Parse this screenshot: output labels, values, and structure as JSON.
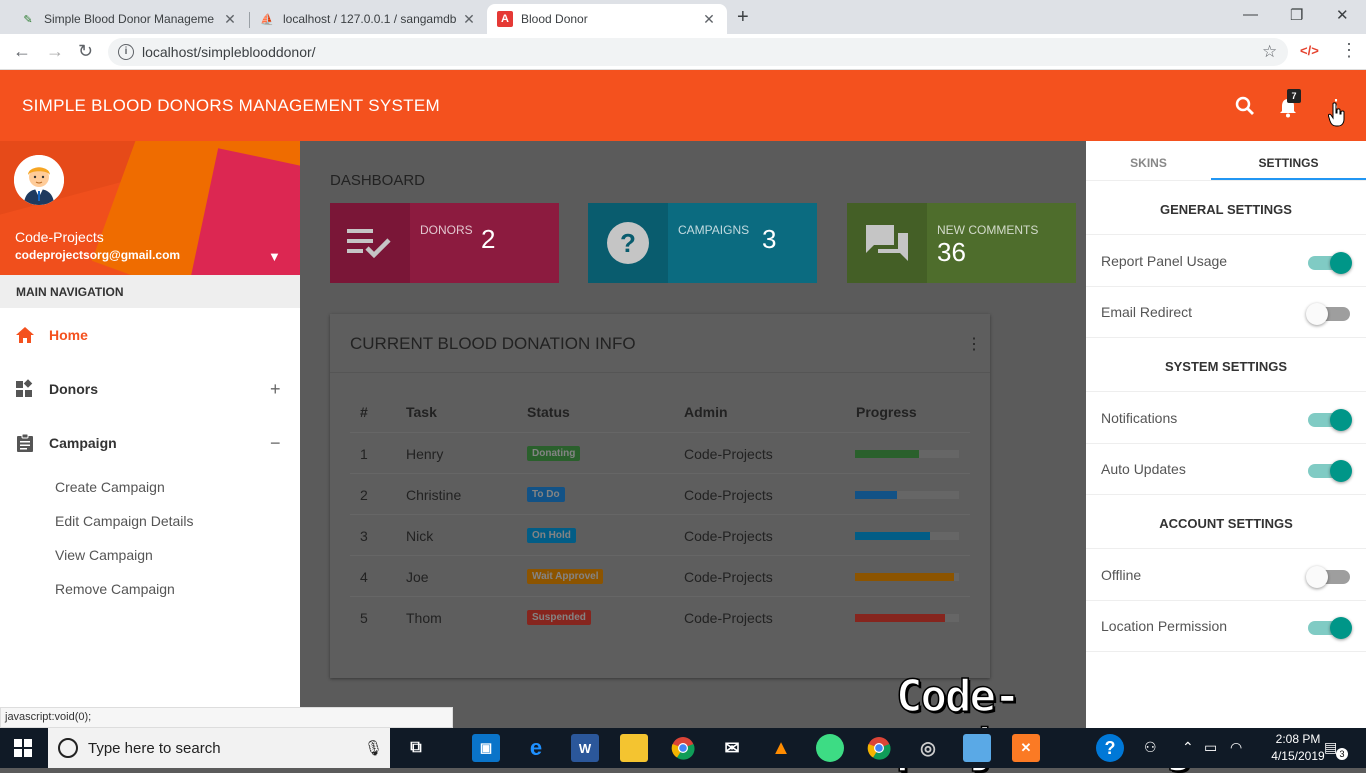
{
  "browser": {
    "tabs": [
      {
        "title": "Simple Blood Donor Manageme",
        "active": false
      },
      {
        "title": "localhost / 127.0.0.1 / sangamdb",
        "active": false
      },
      {
        "title": "Blood Donor",
        "active": true
      }
    ],
    "url": "localhost/simpleblooddonor/",
    "status_text": "javascript:void(0);"
  },
  "header": {
    "title": "SIMPLE BLOOD DONORS MANAGEMENT SYSTEM",
    "notification_count": "7",
    "accent_color": "#f4511e"
  },
  "user": {
    "name": "Code-Projects",
    "email": "codeprojectsorg@gmail.com"
  },
  "sidebar": {
    "section_label": "MAIN NAVIGATION",
    "items": [
      {
        "label": "Home",
        "icon": "home-icon",
        "toggle": ""
      },
      {
        "label": "Donors",
        "icon": "widgets-icon",
        "toggle": "+"
      },
      {
        "label": "Campaign",
        "icon": "assignment-icon",
        "toggle": "−"
      }
    ],
    "campaign_submenu": [
      "Create Campaign",
      "Edit Campaign Details",
      "View Campaign",
      "Remove Campaign"
    ]
  },
  "dashboard": {
    "title": "DASHBOARD",
    "infoboxes": [
      {
        "label": "DONORS",
        "value": "2",
        "color": "#e91e63",
        "icon": "playlist-check-icon"
      },
      {
        "label": "CAMPAIGNS",
        "value": "3",
        "color": "#00bcd4",
        "icon": "help-icon"
      },
      {
        "label": "NEW COMMENTS",
        "value": "36",
        "color": "#8bc34a",
        "icon": "forum-icon"
      }
    ],
    "table_card": {
      "title": "CURRENT BLOOD DONATION INFO",
      "columns": [
        "#",
        "Task",
        "Status",
        "Admin",
        "Progress"
      ],
      "rows": [
        {
          "num": "1",
          "task": "Henry",
          "status": "Donating",
          "status_color": "#4caf50",
          "admin": "Code-Projects",
          "progress": 62,
          "bar_color": "#4caf50"
        },
        {
          "num": "2",
          "task": "Christine",
          "status": "To Do",
          "status_color": "#2196f3",
          "admin": "Code-Projects",
          "progress": 40,
          "bar_color": "#2196f3"
        },
        {
          "num": "3",
          "task": "Nick",
          "status": "On Hold",
          "status_color": "#03a9f4",
          "admin": "Code-Projects",
          "progress": 72,
          "bar_color": "#03a9f4"
        },
        {
          "num": "4",
          "task": "Joe",
          "status": "Wait Approvel",
          "status_color": "#ff9800",
          "admin": "Code-Projects",
          "progress": 95,
          "bar_color": "#ff9800"
        },
        {
          "num": "5",
          "task": "Thom",
          "status": "Suspended",
          "status_color": "#f44336",
          "admin": "Code-Projects",
          "progress": 87,
          "bar_color": "#f44336"
        }
      ]
    }
  },
  "right_panel": {
    "tabs": [
      "SKINS",
      "SETTINGS"
    ],
    "active_tab": "SETTINGS",
    "sections": [
      {
        "heading": "GENERAL SETTINGS",
        "items": [
          {
            "label": "Report Panel Usage",
            "on": true
          },
          {
            "label": "Email Redirect",
            "on": false
          }
        ]
      },
      {
        "heading": "SYSTEM SETTINGS",
        "items": [
          {
            "label": "Notifications",
            "on": true
          },
          {
            "label": "Auto Updates",
            "on": true
          }
        ]
      },
      {
        "heading": "ACCOUNT SETTINGS",
        "items": [
          {
            "label": "Offline",
            "on": false
          },
          {
            "label": "Location Permission",
            "on": true
          }
        ]
      }
    ]
  },
  "watermark": "Code-projects.org",
  "taskbar": {
    "search_placeholder": "Type here to search",
    "time": "2:08 PM",
    "date": "4/15/2019",
    "notification_count": "3"
  }
}
